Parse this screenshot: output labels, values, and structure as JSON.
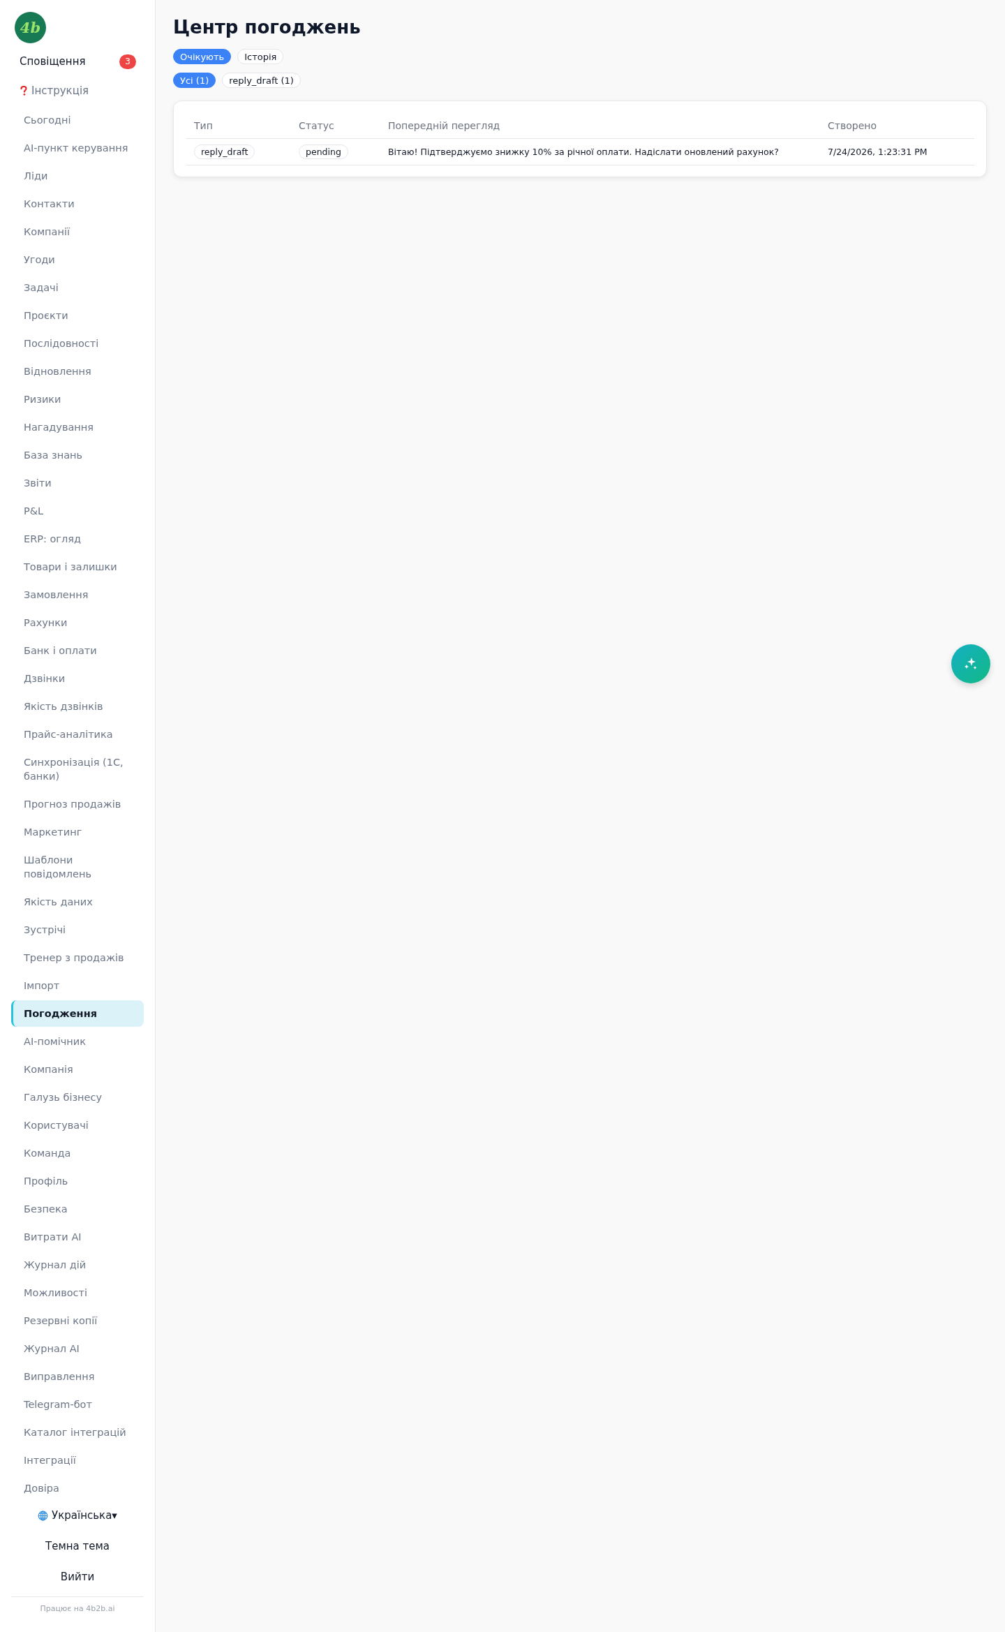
{
  "logo": {
    "text": "4b"
  },
  "notifications": {
    "label": "Сповіщення",
    "count": "3"
  },
  "help": {
    "label": "Інструкція"
  },
  "nav": [
    {
      "label": "Сьогодні",
      "selected": false
    },
    {
      "label": "AI-пункт керування",
      "selected": false
    },
    {
      "label": "Ліди",
      "selected": false
    },
    {
      "label": "Контакти",
      "selected": false
    },
    {
      "label": "Компанії",
      "selected": false
    },
    {
      "label": "Угоди",
      "selected": false
    },
    {
      "label": "Задачі",
      "selected": false
    },
    {
      "label": "Проєкти",
      "selected": false
    },
    {
      "label": "Послідовності",
      "selected": false
    },
    {
      "label": "Відновлення",
      "selected": false
    },
    {
      "label": "Ризики",
      "selected": false
    },
    {
      "label": "Нагадування",
      "selected": false
    },
    {
      "label": "База знань",
      "selected": false
    },
    {
      "label": "Звіти",
      "selected": false
    },
    {
      "label": "P&L",
      "selected": false
    },
    {
      "label": "ERP: огляд",
      "selected": false
    },
    {
      "label": "Товари і залишки",
      "selected": false
    },
    {
      "label": "Замовлення",
      "selected": false
    },
    {
      "label": "Рахунки",
      "selected": false
    },
    {
      "label": "Банк і оплати",
      "selected": false
    },
    {
      "label": "Дзвінки",
      "selected": false
    },
    {
      "label": "Якість дзвінків",
      "selected": false
    },
    {
      "label": "Прайс-аналітика",
      "selected": false
    },
    {
      "label": "Синхронізація (1С, банки)",
      "selected": false
    },
    {
      "label": "Прогноз продажів",
      "selected": false
    },
    {
      "label": "Маркетинг",
      "selected": false
    },
    {
      "label": "Шаблони повідомлень",
      "selected": false
    },
    {
      "label": "Якість даних",
      "selected": false
    },
    {
      "label": "Зустрічі",
      "selected": false
    },
    {
      "label": "Тренер з продажів",
      "selected": false
    },
    {
      "label": "Імпорт",
      "selected": false
    },
    {
      "label": "Погодження",
      "selected": true
    },
    {
      "label": "AI-помічник",
      "selected": false
    },
    {
      "label": "Компанія",
      "selected": false
    },
    {
      "label": "Галузь бізнесу",
      "selected": false
    },
    {
      "label": "Користувачі",
      "selected": false
    },
    {
      "label": "Команда",
      "selected": false
    },
    {
      "label": "Профіль",
      "selected": false
    },
    {
      "label": "Безпека",
      "selected": false
    },
    {
      "label": "Витрати AI",
      "selected": false
    },
    {
      "label": "Журнал дій",
      "selected": false
    },
    {
      "label": "Можливості",
      "selected": false
    },
    {
      "label": "Резервні копії",
      "selected": false
    },
    {
      "label": "Журнал AI",
      "selected": false
    },
    {
      "label": "Виправлення",
      "selected": false
    },
    {
      "label": "Telegram-бот",
      "selected": false
    },
    {
      "label": "Каталог інтеграцій",
      "selected": false
    },
    {
      "label": "Інтеграції",
      "selected": false
    },
    {
      "label": "Довіра",
      "selected": false
    }
  ],
  "language": {
    "label": "Українська",
    "caret": "▾"
  },
  "theme_button": "Темна тема",
  "logout_button": "Вийти",
  "footer": "Працює на 4b2b.ai",
  "main": {
    "title": "Центр погоджень",
    "tabs": [
      {
        "label": "Очікують",
        "selected": true
      },
      {
        "label": "Історія",
        "selected": false
      }
    ],
    "filters": [
      {
        "label": "Усі (1)",
        "selected": true
      },
      {
        "label": "reply_draft (1)",
        "selected": false
      }
    ],
    "table": {
      "columns": [
        "Тип",
        "Статус",
        "Попередній перегляд",
        "Створено"
      ],
      "rows": [
        {
          "type": "reply_draft",
          "status": "pending",
          "preview": "Вітаю! Підтверджуємо знижку 10% за річної оплати. Надіслати оновлений рахунок?",
          "created": "7/24/2026, 1:23:31 PM"
        }
      ]
    }
  }
}
